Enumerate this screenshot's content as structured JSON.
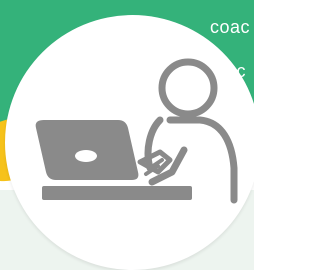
{
  "colors": {
    "green": "#34b27a",
    "yellow": "#f6c21a",
    "mint": "#edf4ef",
    "circle": "#ffffff",
    "icon_gray": "#8a8a8a",
    "text_white": "#ffffff"
  },
  "corner_text": {
    "line1": "coac",
    "line2": "c"
  },
  "illustration": {
    "icon": "person-at-laptop-icon"
  }
}
